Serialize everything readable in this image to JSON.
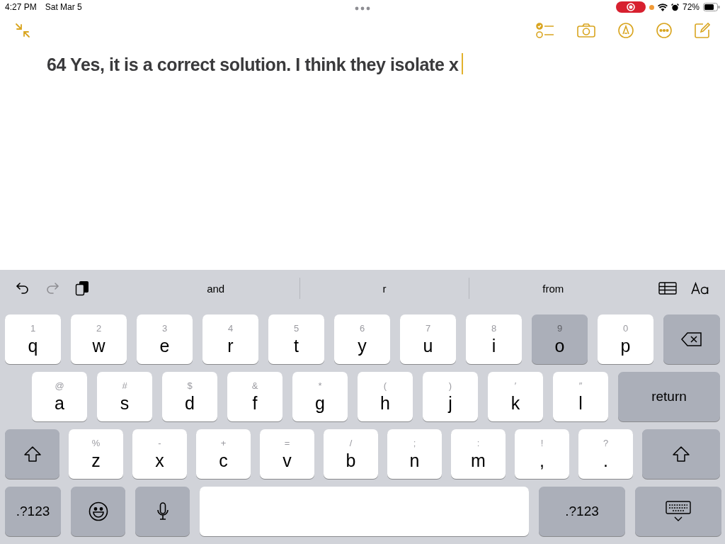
{
  "status_bar": {
    "time": "4:27 PM",
    "date": "Sat Mar 5",
    "battery": "72%"
  },
  "note": {
    "text": "64 Yes, it is a correct solution. I think they isolate x"
  },
  "suggestions": [
    "and",
    "r",
    "from"
  ],
  "key_rows": [
    [
      {
        "kind": "letter",
        "label": "q",
        "alt": "1",
        "pressed": false
      },
      {
        "kind": "letter",
        "label": "w",
        "alt": "2",
        "pressed": false
      },
      {
        "kind": "letter",
        "label": "e",
        "alt": "3",
        "pressed": false
      },
      {
        "kind": "letter",
        "label": "r",
        "alt": "4",
        "pressed": false
      },
      {
        "kind": "letter",
        "label": "t",
        "alt": "5",
        "pressed": false
      },
      {
        "kind": "letter",
        "label": "y",
        "alt": "6",
        "pressed": false
      },
      {
        "kind": "letter",
        "label": "u",
        "alt": "7",
        "pressed": false
      },
      {
        "kind": "letter",
        "label": "i",
        "alt": "8",
        "pressed": false
      },
      {
        "kind": "letter",
        "label": "o",
        "alt": "9",
        "pressed": true
      },
      {
        "kind": "letter",
        "label": "p",
        "alt": "0",
        "pressed": false
      },
      {
        "kind": "delete"
      }
    ],
    [
      {
        "kind": "letter",
        "label": "a",
        "alt": "@",
        "pressed": false
      },
      {
        "kind": "letter",
        "label": "s",
        "alt": "#",
        "pressed": false
      },
      {
        "kind": "letter",
        "label": "d",
        "alt": "$",
        "pressed": false
      },
      {
        "kind": "letter",
        "label": "f",
        "alt": "&",
        "pressed": false
      },
      {
        "kind": "letter",
        "label": "g",
        "alt": "*",
        "pressed": false
      },
      {
        "kind": "letter",
        "label": "h",
        "alt": "(",
        "pressed": false
      },
      {
        "kind": "letter",
        "label": "j",
        "alt": ")",
        "pressed": false
      },
      {
        "kind": "letter",
        "label": "k",
        "alt": "′",
        "pressed": false
      },
      {
        "kind": "letter",
        "label": "l",
        "alt": "″",
        "pressed": false
      },
      {
        "kind": "return",
        "label": "return"
      }
    ],
    [
      {
        "kind": "shift"
      },
      {
        "kind": "letter",
        "label": "z",
        "alt": "%",
        "pressed": false
      },
      {
        "kind": "letter",
        "label": "x",
        "alt": "-",
        "pressed": false
      },
      {
        "kind": "letter",
        "label": "c",
        "alt": "+",
        "pressed": false
      },
      {
        "kind": "letter",
        "label": "v",
        "alt": "=",
        "pressed": false
      },
      {
        "kind": "letter",
        "label": "b",
        "alt": "/",
        "pressed": false
      },
      {
        "kind": "letter",
        "label": "n",
        "alt": ";",
        "pressed": false
      },
      {
        "kind": "letter",
        "label": "m",
        "alt": ":",
        "pressed": false
      },
      {
        "kind": "letter",
        "label": ",",
        "alt": "!",
        "pressed": false
      },
      {
        "kind": "letter",
        "label": ".",
        "alt": "?",
        "pressed": false
      },
      {
        "kind": "shift"
      }
    ],
    [
      {
        "kind": "numbers",
        "label": ".?123"
      },
      {
        "kind": "emoji"
      },
      {
        "kind": "dictation"
      },
      {
        "kind": "space"
      },
      {
        "kind": "numbers",
        "label": ".?123"
      },
      {
        "kind": "hide"
      }
    ]
  ]
}
